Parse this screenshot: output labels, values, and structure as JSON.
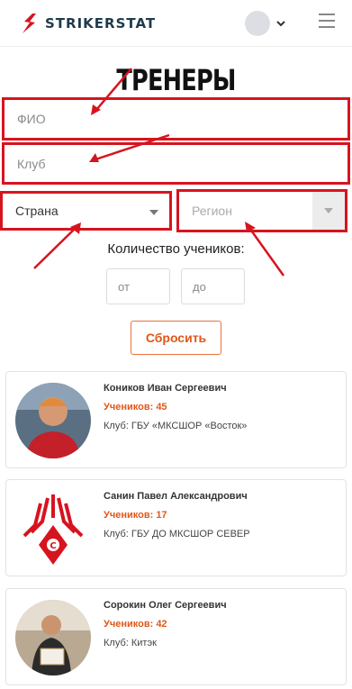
{
  "header": {
    "logo_text": "STRIKERSTAT",
    "brand_color": "#1e3a4c",
    "logo_accent": "#d6141f"
  },
  "page_title": "ТРЕНЕРЫ",
  "filters": {
    "fio_placeholder": "ФИО",
    "club_placeholder": "Клуб",
    "country_label": "Страна",
    "region_label": "Регион"
  },
  "count": {
    "label": "Количество учеников:",
    "from_placeholder": "от",
    "to_placeholder": "до"
  },
  "reset_label": "Сбросить",
  "accent_color": "#e0571a",
  "highlight_color": "#d6141f",
  "coaches": [
    {
      "name": "Коников Иван Сергеевич",
      "count": "Учеников: 45",
      "club": "Клуб: ГБУ «МКСШОР «Восток»"
    },
    {
      "name": "Санин Павел Александрович",
      "count": "Учеников: 17",
      "club": "Клуб: ГБУ ДО МКСШОР СЕВЕР"
    },
    {
      "name": "Сорокин Олег Сергеевич",
      "count": "Учеников: 42",
      "club": "Клуб: Китэк"
    }
  ]
}
